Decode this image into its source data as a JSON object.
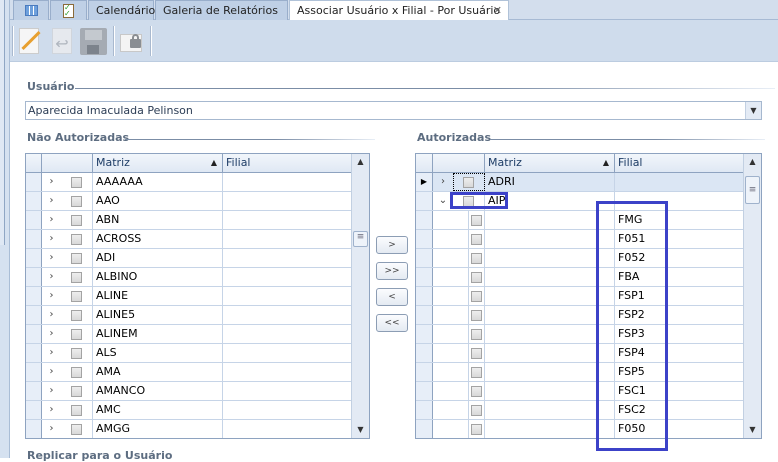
{
  "tabs": [
    {
      "label": "",
      "icon": "grid-icon"
    },
    {
      "label": "",
      "icon": "checklist-icon"
    },
    {
      "label": "Calendário"
    },
    {
      "label": "Galeria de Relatórios"
    },
    {
      "label": "Associar Usuário x Filial - Por Usuário",
      "active": true
    }
  ],
  "tab_close": "✕",
  "toolbar": [
    "edit-icon",
    "undo-icon",
    "save-icon",
    "lock-icon"
  ],
  "usuario": {
    "label": "Usuário",
    "value": "Aparecida Imaculada Pelinson"
  },
  "left_grid": {
    "title": "Não Autorizadas",
    "columns": [
      "Matriz",
      "Filial"
    ],
    "rows": [
      "AAAAAA",
      "AAO",
      "ABN",
      "ACROSS",
      "ADI",
      "ALBINO",
      "ALINE",
      "ALINE5",
      "ALINEM",
      "ALS",
      "AMA",
      "AMANCO",
      "AMC",
      "AMGG"
    ]
  },
  "move_buttons": [
    ">",
    ">>",
    "<",
    "<<"
  ],
  "right_grid": {
    "title": "Autorizadas",
    "columns": [
      "Matriz",
      "Filial"
    ],
    "groups": [
      {
        "matriz": "ADRI",
        "expanded": false,
        "selected": true
      },
      {
        "matriz": "AIP",
        "expanded": true
      }
    ],
    "children": [
      "FMG",
      "F051",
      "F052",
      "FBA",
      "FSP1",
      "FSP2",
      "FSP3",
      "FSP4",
      "FSP5",
      "FSC1",
      "FSC2",
      "F050"
    ]
  },
  "replicar_label": "Replicar para o Usuário",
  "colors": {
    "highlight": "#3c42c8",
    "selected_row": "#dbe6f4"
  }
}
